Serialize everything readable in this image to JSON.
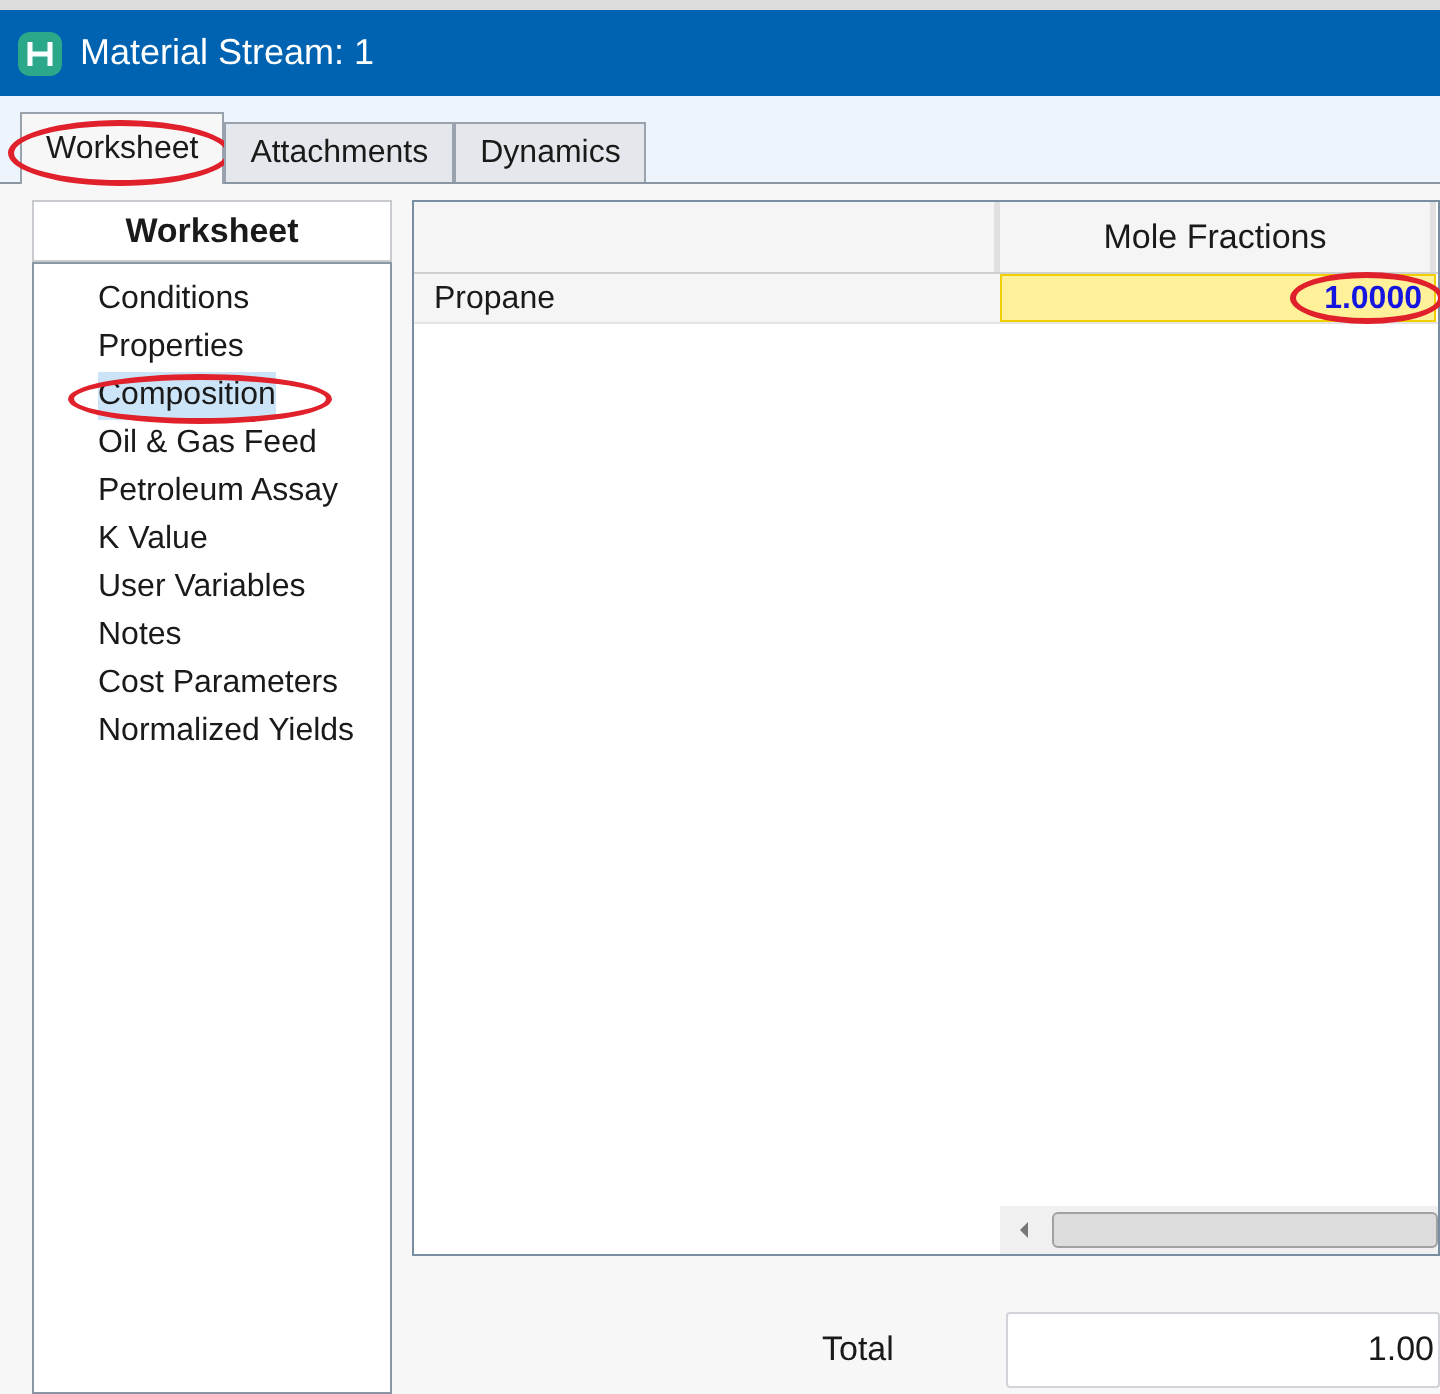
{
  "window": {
    "title": "Material Stream: 1"
  },
  "tabs": [
    {
      "label": "Worksheet",
      "selected": true,
      "circled": true
    },
    {
      "label": "Attachments",
      "selected": false,
      "circled": false
    },
    {
      "label": "Dynamics",
      "selected": false,
      "circled": false
    }
  ],
  "sidebar": {
    "header": "Worksheet",
    "items": [
      {
        "label": "Conditions",
        "selected": false,
        "circled": false
      },
      {
        "label": "Properties",
        "selected": false,
        "circled": false
      },
      {
        "label": "Composition",
        "selected": true,
        "circled": true
      },
      {
        "label": "Oil & Gas Feed",
        "selected": false,
        "circled": false
      },
      {
        "label": "Petroleum Assay",
        "selected": false,
        "circled": false
      },
      {
        "label": "K Value",
        "selected": false,
        "circled": false
      },
      {
        "label": "User Variables",
        "selected": false,
        "circled": false
      },
      {
        "label": "Notes",
        "selected": false,
        "circled": false
      },
      {
        "label": "Cost Parameters",
        "selected": false,
        "circled": false
      },
      {
        "label": "Normalized Yields",
        "selected": false,
        "circled": false
      }
    ]
  },
  "table": {
    "columns": [
      "Mole Fractions"
    ],
    "rows": [
      {
        "name": "Propane",
        "value": "1.0000",
        "circled": true
      }
    ]
  },
  "total": {
    "label": "Total",
    "value": "1.00"
  }
}
